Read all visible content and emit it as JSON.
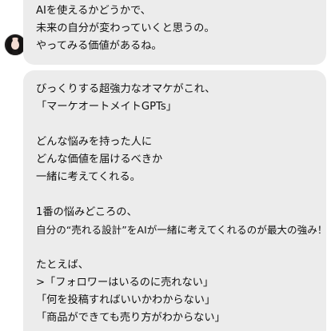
{
  "messages": [
    {
      "lines": [
        "AIを使えるかどうかで、",
        "未来の自分が変わっていくと思うの。",
        "やってみる価値があるね。"
      ]
    },
    {
      "lines": [
        "びっくりする超強力なオマケがこれ、",
        "「マーケオートメイトGPTs」",
        "",
        "どんな悩みを持った人に",
        "どんな価値を届けるべきか",
        "一緒に考えてくれる。",
        "",
        "1番の悩みどころの、",
        "自分の“売れる設計”をAIが一緒に考えてくれるのが最大の強み！",
        "",
        "たとえば、",
        ">「フォロワーはいるのに売れない」",
        "「何を投稿すればいいかわからない」",
        "「商品ができても売り方がわからない」"
      ]
    }
  ]
}
